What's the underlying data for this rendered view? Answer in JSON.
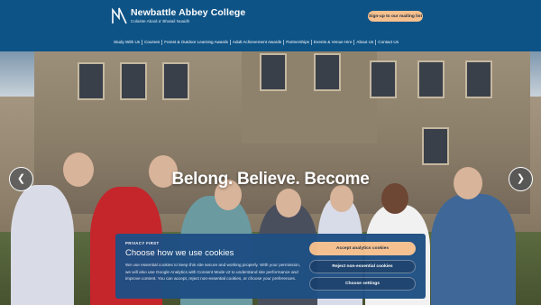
{
  "header": {
    "logo_title": "Newbattle Abbey College",
    "logo_subtitle": "Colaiste Abaid a' Bhatail Nuaidh",
    "mailing_button": "Sign-up to our mailing list"
  },
  "nav": {
    "items": [
      "Study With Us",
      "Courses",
      "Forest & Outdoor Learning Awards",
      "Adult Achievement Awards",
      "Partnerships",
      "Events & Venue Hire",
      "About Us",
      "Contact Us"
    ]
  },
  "hero": {
    "headline": "Belong. Believe. Become",
    "prev_arrow": "❮",
    "next_arrow": "❯"
  },
  "consent": {
    "eyebrow": "PRIVACY FIRST",
    "title": "Choose how we use cookies",
    "body": "We use essential cookies to keep this site secure and working properly. With your permission, we will also use Google Analytics with Consent Mode v2 to understand site performance and improve content. You can accept, reject non-essential cookies, or choose your preferences.",
    "accept_label": "Accept analytics cookies",
    "reject_label": "Reject non-essential cookies",
    "settings_label": "Choose settings"
  },
  "colors": {
    "header_bg": "#0e5386",
    "accent": "#f6c08e",
    "consent_bg": "#1f4f84"
  }
}
